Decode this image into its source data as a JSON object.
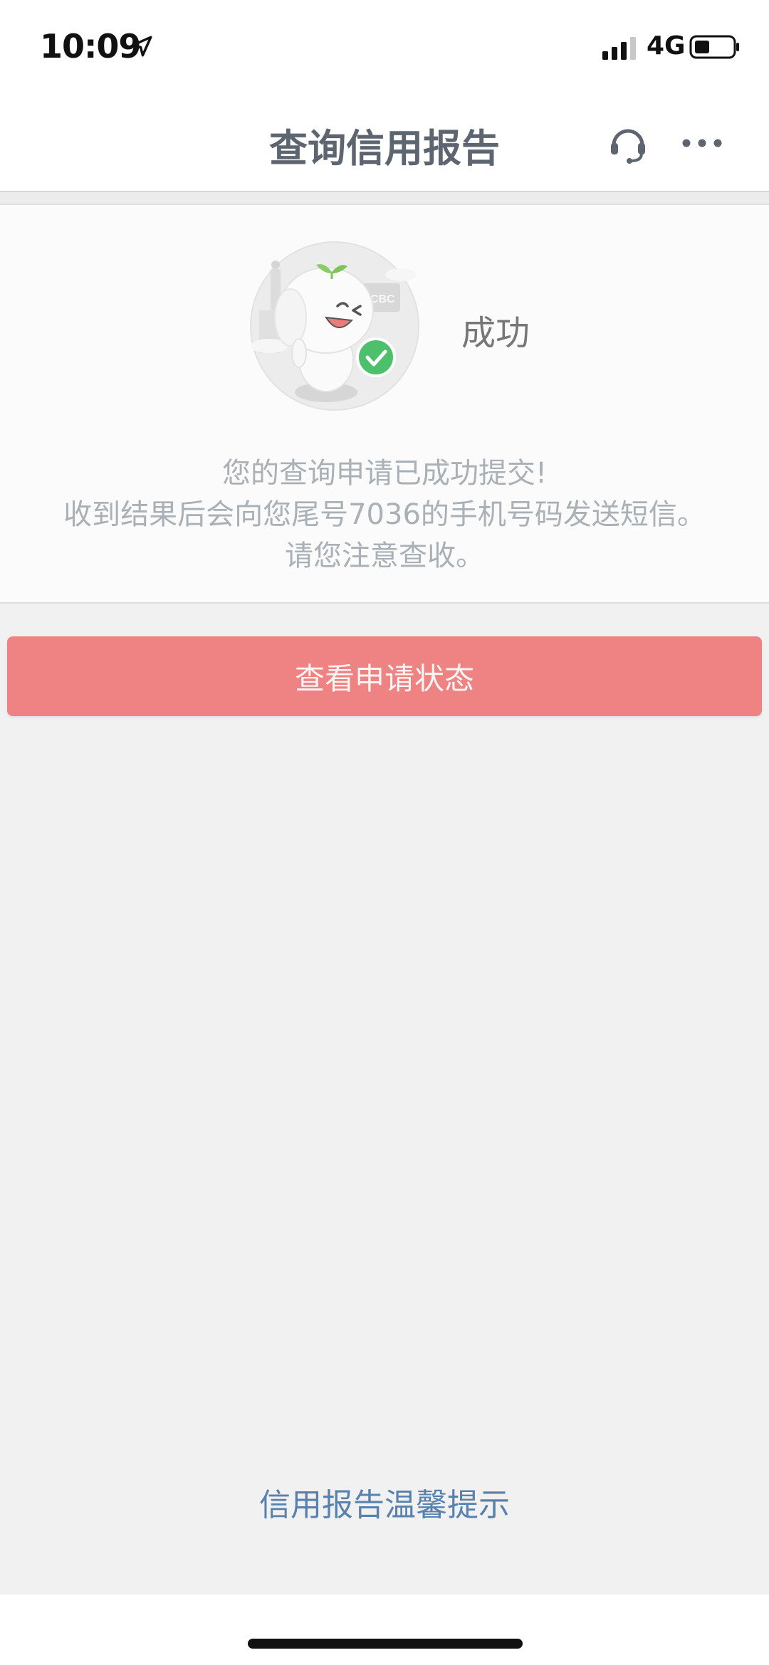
{
  "status_bar": {
    "time": "10:09",
    "network": "4G",
    "icons": [
      "location-arrow-icon",
      "signal-bars-icon",
      "battery-icon"
    ]
  },
  "nav": {
    "title": "查询信用报告",
    "icons": [
      "customer-service-headset-icon",
      "more-dots-icon"
    ]
  },
  "result": {
    "title": "成功",
    "mascot_badge_text": "ICBC",
    "message_lines": [
      "您的查询申请已成功提交!",
      "收到结果后会向您尾号7036的手机号码发送短信。",
      "请您注意查收。"
    ]
  },
  "actions": {
    "view_status_label": "查看申请状态"
  },
  "footer": {
    "tips_link": "信用报告温馨提示"
  },
  "colors": {
    "primary_button": "#ef8282",
    "link": "#5882ad",
    "success_check": "#4cc06a",
    "nav_text": "#5d6670"
  }
}
